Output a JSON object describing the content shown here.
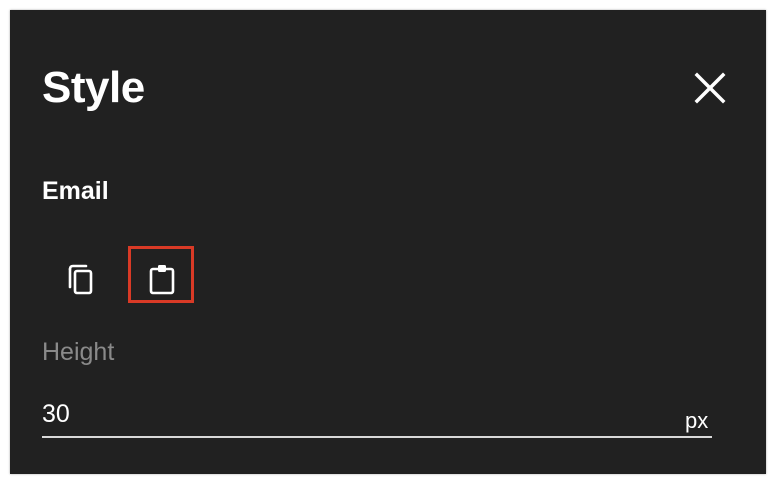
{
  "dialog": {
    "title": "Style",
    "close_icon": "close-icon"
  },
  "section": {
    "label": "Email",
    "actions": [
      {
        "name": "copy",
        "icon": "copy-icon"
      },
      {
        "name": "paste",
        "icon": "clipboard-icon",
        "highlighted": true
      }
    ]
  },
  "height_field": {
    "label": "Height",
    "value": "30",
    "unit": "px"
  },
  "colors": {
    "panel_background": "#212121",
    "text": "#ffffff",
    "muted_label": "#8a8a8a",
    "highlight_border": "#d93a26"
  }
}
